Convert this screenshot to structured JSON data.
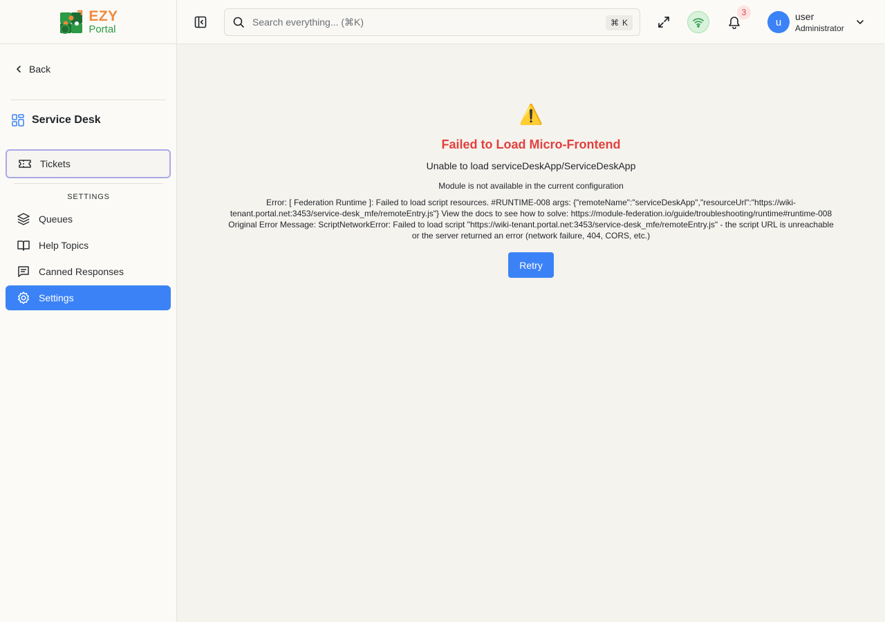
{
  "brand": {
    "name_top": "EZY",
    "name_bottom": "Portal"
  },
  "sidebar": {
    "back_label": "Back",
    "section_title": "Service Desk",
    "items": [
      {
        "label": "Tickets",
        "icon": "ticket-icon"
      },
      {
        "label": "Queues",
        "icon": "layers-icon"
      },
      {
        "label": "Help Topics",
        "icon": "book-icon"
      },
      {
        "label": "Canned Responses",
        "icon": "message-icon"
      },
      {
        "label": "Settings",
        "icon": "gear-icon"
      }
    ],
    "settings_group_label": "SETTINGS"
  },
  "topbar": {
    "search_placeholder": "Search everything... (⌘K)",
    "shortcut_symbol": "⌘",
    "shortcut_key": "K",
    "notification_count": "3",
    "user_initial": "u",
    "user_name": "user",
    "user_role": "Administrator"
  },
  "error": {
    "icon": "⚠️",
    "title": "Failed to Load Micro-Frontend",
    "subtitle": "Unable to load serviceDeskApp/ServiceDeskApp",
    "module_message": "Module is not available in the current configuration",
    "detail": "Error: [ Federation Runtime ]: Failed to load script resources. #RUNTIME-008 args: {\"remoteName\":\"serviceDeskApp\",\"resourceUrl\":\"https://wiki-tenant.portal.net:3453/service-desk_mfe/remoteEntry.js\"} View the docs to see how to solve: https://module-federation.io/guide/troubleshooting/runtime#runtime-008 Original Error Message: ScriptNetworkError: Failed to load script \"https://wiki-tenant.portal.net:3453/service-desk_mfe/remoteEntry.js\" - the script URL is unreachable or the server returned an error (network failure, 404, CORS, etc.)",
    "retry_label": "Retry"
  },
  "colors": {
    "accent": "#3b82f6",
    "error": "#e2403e",
    "brand_orange": "#f08a3c",
    "brand_green": "#2c9a46"
  }
}
